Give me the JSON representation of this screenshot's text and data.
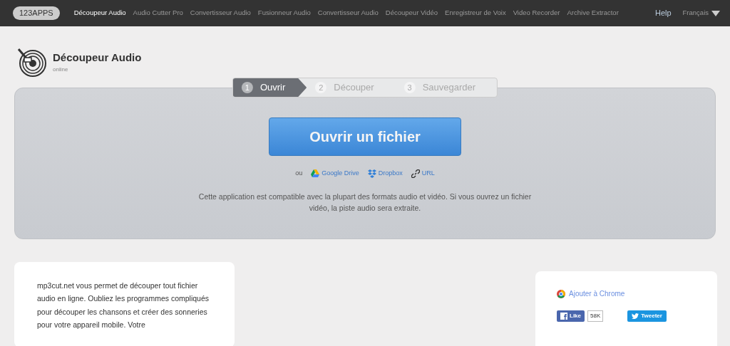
{
  "navbar": {
    "logo": "123APPS",
    "items": [
      {
        "label": "Découpeur Audio",
        "selected": true
      },
      {
        "label": "Audio Cutter Pro",
        "selected": false
      },
      {
        "label": "Convertisseur Audio",
        "selected": false
      },
      {
        "label": "Fusionneur Audio",
        "selected": false
      },
      {
        "label": "Convertisseur Audio",
        "selected": false
      },
      {
        "label": "Découpeur Vidéo",
        "selected": false
      },
      {
        "label": "Enregistreur de Voix",
        "selected": false
      },
      {
        "label": "Video Recorder",
        "selected": false
      },
      {
        "label": "Archive Extractor",
        "selected": false
      }
    ],
    "help": "Help",
    "language": "Français"
  },
  "header": {
    "title": "Découpeur Audio",
    "subtitle": "online"
  },
  "steps": [
    {
      "number": "1",
      "label": "Ouvrir",
      "selected": true
    },
    {
      "number": "2",
      "label": "Découper",
      "selected": false
    },
    {
      "number": "3",
      "label": "Sauvegarder",
      "selected": false
    }
  ],
  "open_button": "Ouvrir un fichier",
  "sources": {
    "prefix": "ou",
    "links": [
      {
        "kind": "drive",
        "label": "Google Drive"
      },
      {
        "kind": "dropbox",
        "label": "Dropbox"
      },
      {
        "kind": "url",
        "label": "URL"
      }
    ]
  },
  "description": "Cette application est compatible avec la plupart des formats audio et vidéo. Si vous ouvrez un fichier vidéo, la piste audio sera extraite.",
  "intro_text": "mp3cut.net vous permet de découper tout fichier audio en ligne. Oubliez les programmes compliqués pour découper les chansons et créer des sonneries pour votre appareil mobile. Votre",
  "social": {
    "chrome_link": "Ajouter à Chrome",
    "like": "Like",
    "like_count": "58K",
    "tweet": "Tweeter"
  }
}
